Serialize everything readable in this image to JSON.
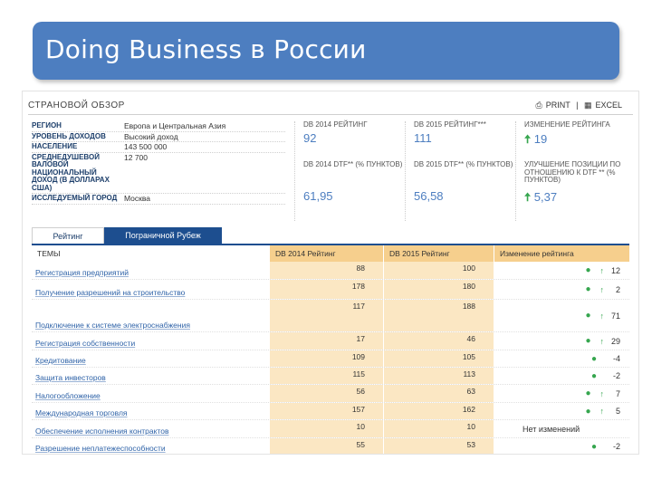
{
  "slide": {
    "title": "Doing Business в России"
  },
  "header": {
    "section": "СТРАНОВОЙ ОБЗОР",
    "print": "PRINT",
    "sep": "|",
    "excel": "EXCEL"
  },
  "info": [
    {
      "label": "РЕГИОН",
      "value": "Европа и Центральная Азия"
    },
    {
      "label": "УРОВЕНЬ ДОХОДОВ",
      "value": "Высокий доход"
    },
    {
      "label": "НАСЕЛЕНИЕ",
      "value": "143 500 000"
    },
    {
      "label": "СРЕДНЕДУШЕВОЙ ВАЛОВОЙ НАЦИОНАЛЬНЫЙ ДОХОД (В ДОЛЛАРАХ США)",
      "value": "12 700"
    },
    {
      "label": "ИССЛЕДУЕМЫЙ ГОРОД",
      "value": "Москва"
    }
  ],
  "stats": {
    "rank2014": {
      "label": "DB 2014 РЕЙТИНГ",
      "value": "92"
    },
    "rank2015": {
      "label": "DB 2015 РЕЙТИНГ***",
      "value": "111"
    },
    "rankChange": {
      "label": "ИЗМЕНЕНИЕ РЕЙТИНГА",
      "value": "19"
    },
    "dtf2014": {
      "label": "DB 2014 DTF** (% ПУНКТОВ)",
      "value": "61,95"
    },
    "dtf2015": {
      "label": "DB 2015 DTF** (% ПУНКТОВ)",
      "value": "56,58"
    },
    "dtfChange": {
      "label": "УЛУЧШЕНИЕ ПОЗИЦИИ ПО ОТНОШЕНИЮ К DTF ** (% ПУНКТОВ)",
      "value": "5,37"
    }
  },
  "tabs": [
    "Рейтинг",
    "Пограничной Рубеж"
  ],
  "table": {
    "headers": [
      "ТЕМЫ",
      "DB 2014 Рейтинг",
      "DB 2015 Рейтинг",
      "Изменение рейтинга"
    ],
    "rows": [
      {
        "topic": "Регистрация предприятий",
        "db2014": "88",
        "db2015": "100",
        "change": "12"
      },
      {
        "topic": "Получение разрешений на строительство",
        "db2014": "178",
        "db2015": "180",
        "change": "2"
      },
      {
        "topic": "Подключение к системе электроснабжения",
        "db2014": "117",
        "db2015": "188",
        "change": "71"
      },
      {
        "topic": "Регистрация собственности",
        "db2014": "17",
        "db2015": "46",
        "change": "29"
      },
      {
        "topic": "Кредитование",
        "db2014": "109",
        "db2015": "105",
        "change": "-4"
      },
      {
        "topic": "Защита инвесторов",
        "db2014": "115",
        "db2015": "113",
        "change": "-2"
      },
      {
        "topic": "Налогообложение",
        "db2014": "56",
        "db2015": "63",
        "change": "7"
      },
      {
        "topic": "Международная торговля",
        "db2014": "157",
        "db2015": "162",
        "change": "5"
      },
      {
        "topic": "Обеспечение исполнения контрактов",
        "db2014": "10",
        "db2015": "10",
        "change": "Нет изменений"
      },
      {
        "topic": "Разрешение неплатежеспособности",
        "db2014": "55",
        "db2015": "53",
        "change": "-2"
      }
    ]
  },
  "colors": {
    "titleBox": "#4d7ec0",
    "tableHeader": "#f6cf8d",
    "tableCell": "#fbe7c3",
    "link": "#2f63a8",
    "positive": "#36a64f"
  }
}
